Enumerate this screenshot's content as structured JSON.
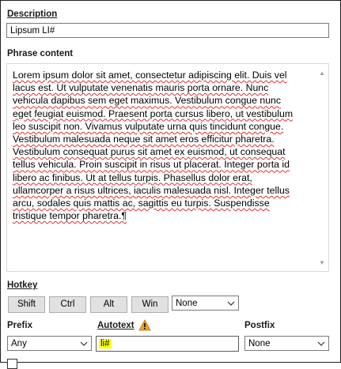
{
  "description": {
    "label": "Description",
    "value": "Lipsum LI#"
  },
  "phrase_content": {
    "label": "Phrase content",
    "lines": [
      "Lorem ipsum dolor sit amet, consectetur adipiscing elit. Duis vel",
      "lacus est. Ut vulputate venenatis mauris porta ornare. Nunc",
      "vehicula dapibus sem eget maximus. Vestibulum congue nunc",
      "eget feugiat euismod. Praesent porta cursus libero, ut vestibulum",
      "leo suscipit non. Vivamus vulputate urna quis tincidunt congue.",
      "Vestibulum malesuada neque sit amet eros efficitur pharetra.",
      "Vestibulum consequat purus sit amet ex euismod, ut consequat",
      "tellus vehicula. Proin suscipit in risus ut placerat. Integer porta id",
      "libero ac finibus. Ut at tellus turpis. Phasellus dolor erat,",
      "ullamcorper a risus ultrices, iaculis malesuada nisl. Integer tellus",
      "arcu, sodales quis mattis ac, sagittis eu turpis. Suspendisse",
      "tristique tempor pharetra.¶"
    ]
  },
  "hotkey": {
    "label": "Hotkey",
    "buttons": [
      "Shift",
      "Ctrl",
      "Alt",
      "Win"
    ],
    "key_select": "None"
  },
  "prefix": {
    "label": "Prefix",
    "value": "Any"
  },
  "autotext": {
    "label": "Autotext",
    "value": "li#",
    "warning_icon": "warning-triangle-icon",
    "highlight_color": "#ffff00"
  },
  "postfix": {
    "label": "Postfix",
    "value": "None"
  }
}
